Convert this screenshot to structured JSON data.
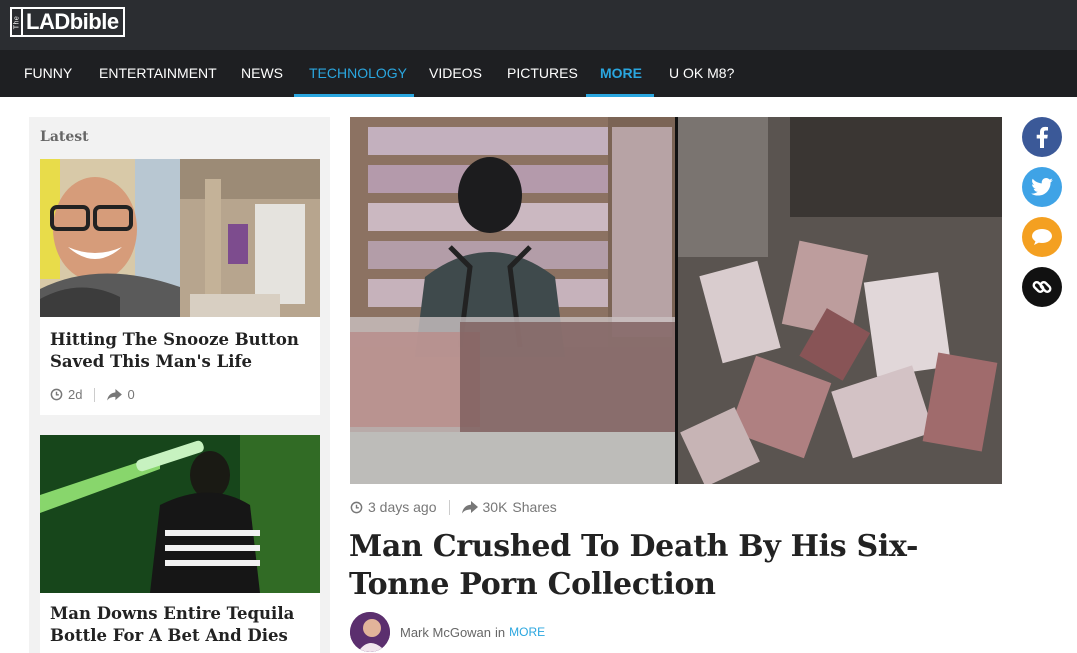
{
  "brand": {
    "the": "The",
    "name": "LADbible"
  },
  "nav": {
    "items": [
      {
        "label": "FUNNY"
      },
      {
        "label": "ENTERTAINMENT"
      },
      {
        "label": "NEWS"
      },
      {
        "label": "TECHNOLOGY"
      },
      {
        "label": "VIDEOS"
      },
      {
        "label": "PICTURES"
      },
      {
        "label": "MORE"
      },
      {
        "label": "U OK M8?"
      }
    ]
  },
  "sidebar": {
    "title": "Latest",
    "cards": [
      {
        "title": "Hitting The Snooze Button Saved This Man's Life",
        "time": "2d",
        "shares": "0"
      },
      {
        "title": "Man Downs Entire Tequila Bottle For A Bet And Dies"
      }
    ]
  },
  "article": {
    "time": "3 days ago",
    "shares": "30K",
    "shares_label": "Shares",
    "title": "Man Crushed To Death By His Six-Tonne Porn Collection",
    "author": "Mark McGowan",
    "author_in": "in",
    "category": "MORE"
  },
  "icons": {
    "clock": "clock-icon",
    "share": "share-arrow-icon",
    "facebook": "facebook-icon",
    "twitter": "twitter-icon",
    "comment": "comment-icon",
    "link": "link-icon"
  },
  "colors": {
    "topbar": "#2b2d31",
    "navbar": "#1e1f22",
    "accent": "#2aa6df",
    "facebook": "#3b5998",
    "twitter": "#3fa3e6",
    "comment": "#f4a021",
    "link": "#111111"
  }
}
